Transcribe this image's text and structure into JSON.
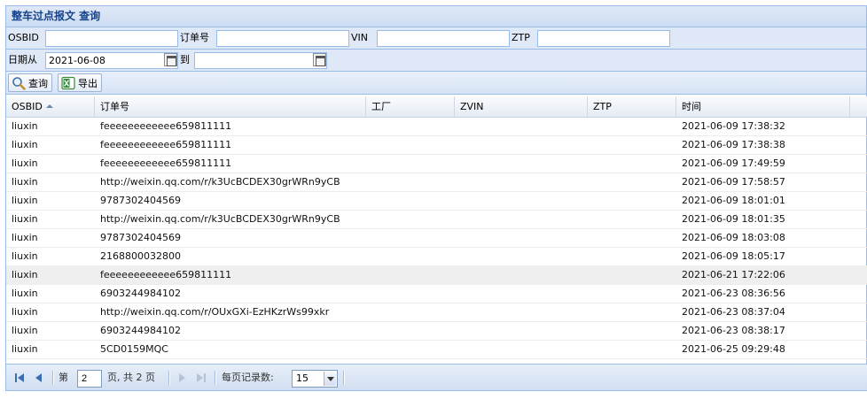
{
  "panel": {
    "title": "整车过点报文 查询"
  },
  "filters": {
    "osbid_label": "OSBID",
    "osbid_value": "",
    "order_label": "订单号",
    "order_value": "",
    "vin_label": "VIN",
    "vin_value": "",
    "ztp_label": "ZTP",
    "ztp_value": "",
    "date_from_label": "日期从",
    "date_from_value": "2021-06-08",
    "date_to_label": "到",
    "date_to_value": ""
  },
  "toolbar": {
    "query_label": "查询",
    "export_label": "导出"
  },
  "grid": {
    "columns": [
      "OSBID",
      "订单号",
      "工厂",
      "ZVIN",
      "ZTP",
      "时间"
    ],
    "rows": [
      [
        "liuxin",
        "feeeeeeeeeeee659811111",
        "",
        "",
        "",
        "2021-06-09 17:38:32"
      ],
      [
        "liuxin",
        "feeeeeeeeeeee659811111",
        "",
        "",
        "",
        "2021-06-09 17:38:38"
      ],
      [
        "liuxin",
        "feeeeeeeeeeee659811111",
        "",
        "",
        "",
        "2021-06-09 17:49:59"
      ],
      [
        "liuxin",
        "http://weixin.qq.com/r/k3UcBCDEX30grWRn9yCB",
        "",
        "",
        "",
        "2021-06-09 17:58:57"
      ],
      [
        "liuxin",
        "9787302404569",
        "",
        "",
        "",
        "2021-06-09 18:01:01"
      ],
      [
        "liuxin",
        "http://weixin.qq.com/r/k3UcBCDEX30grWRn9yCB",
        "",
        "",
        "",
        "2021-06-09 18:01:35"
      ],
      [
        "liuxin",
        "9787302404569",
        "",
        "",
        "",
        "2021-06-09 18:03:08"
      ],
      [
        "liuxin",
        "2168800032800",
        "",
        "",
        "",
        "2021-06-09 18:05:17"
      ],
      [
        "liuxin",
        "feeeeeeeeeeee659811111",
        "",
        "",
        "",
        "2021-06-21 17:22:06"
      ],
      [
        "liuxin",
        "6903244984102",
        "",
        "",
        "",
        "2021-06-23 08:36:56"
      ],
      [
        "liuxin",
        "http://weixin.qq.com/r/OUxGXi-EzHKzrWs99xkr",
        "",
        "",
        "",
        "2021-06-23 08:37:04"
      ],
      [
        "liuxin",
        "6903244984102",
        "",
        "",
        "",
        "2021-06-23 08:38:17"
      ],
      [
        "liuxin",
        "5CD0159MQC",
        "",
        "",
        "",
        "2021-06-25 09:29:48"
      ]
    ],
    "selected_row": 8
  },
  "pager": {
    "page_prefix": "第",
    "current_page": "2",
    "page_suffix": "页, 共 2 页",
    "page_size_label": "每页记录数:",
    "page_size": "15"
  },
  "colors": {
    "accent": "#15428b",
    "border": "#99bbe8",
    "header_bg": "#dfe8f6"
  }
}
